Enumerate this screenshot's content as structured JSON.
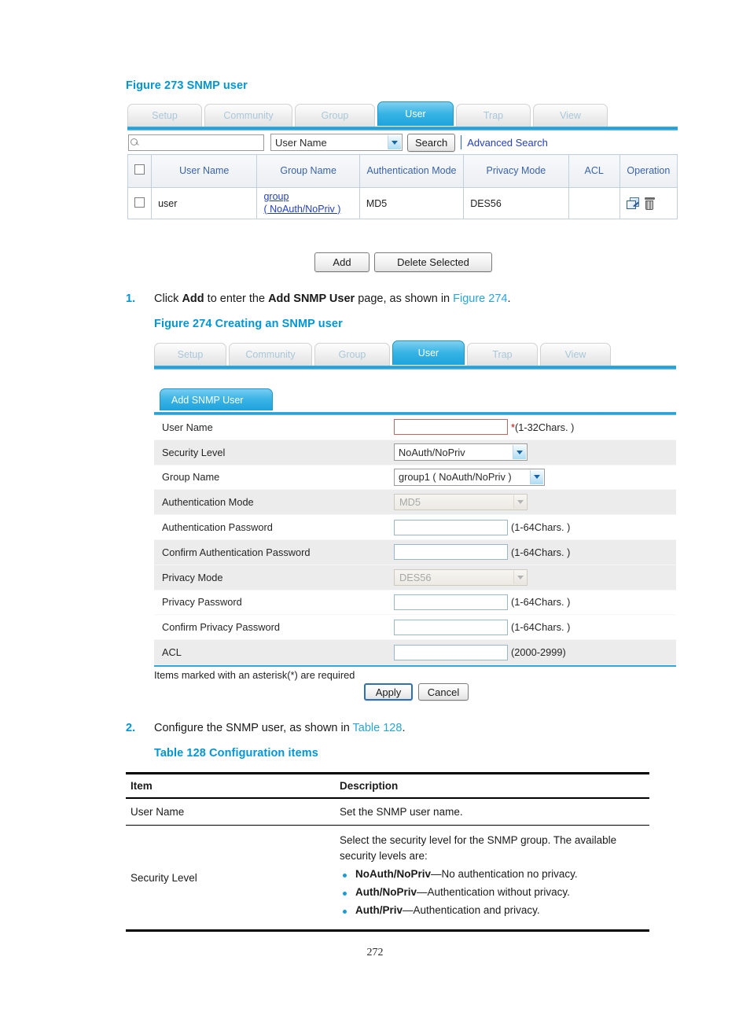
{
  "figure273": {
    "caption": "Figure 273 SNMP user",
    "tabs": [
      {
        "label": "Setup",
        "active": false
      },
      {
        "label": "Community",
        "active": false
      },
      {
        "label": "Group",
        "active": false
      },
      {
        "label": "User",
        "active": true
      },
      {
        "label": "Trap",
        "active": false
      },
      {
        "label": "View",
        "active": false
      }
    ],
    "search": {
      "input_value": "",
      "field_select": "User Name",
      "search_button": "Search",
      "advanced_link": "Advanced Search"
    },
    "table": {
      "headers": [
        "",
        "User Name",
        "Group Name",
        "Authentication Mode",
        "Privacy Mode",
        "ACL",
        "Operation"
      ],
      "rows": [
        {
          "user_name": "user",
          "group_name_line1": "group",
          "group_name_line2": "( NoAuth/NoPriv )",
          "auth_mode": "MD5",
          "privacy_mode": "DES56",
          "acl": "",
          "operation_icons": [
            "edit-icon",
            "delete-icon"
          ]
        }
      ]
    },
    "buttons": {
      "add": "Add",
      "delete_selected": "Delete Selected"
    }
  },
  "step1": {
    "number": "1.",
    "text_pre": "Click ",
    "bold1": "Add",
    "text_mid": " to enter the ",
    "bold2": "Add SNMP User",
    "text_post": " page, as shown in ",
    "ref": "Figure 274",
    "text_end": "."
  },
  "figure274": {
    "caption": "Figure 274 Creating an SNMP user",
    "tabs": [
      {
        "label": "Setup",
        "active": false
      },
      {
        "label": "Community",
        "active": false
      },
      {
        "label": "Group",
        "active": false
      },
      {
        "label": "User",
        "active": true
      },
      {
        "label": "Trap",
        "active": false
      },
      {
        "label": "View",
        "active": false
      }
    ],
    "panel_tab": "Add SNMP User",
    "fields": [
      {
        "label": "User Name",
        "type": "text",
        "value": "",
        "hint": "*(1-32Chars. )",
        "required": true,
        "shade": "white"
      },
      {
        "label": "Security Level",
        "type": "select",
        "value": "NoAuth/NoPriv",
        "hint": "",
        "disabled": false,
        "shade": "gray"
      },
      {
        "label": "Group Name",
        "type": "select",
        "value": "group1 ( NoAuth/NoPriv )",
        "hint": "",
        "disabled": false,
        "shade": "white"
      },
      {
        "label": "Authentication Mode",
        "type": "select",
        "value": "MD5",
        "hint": "",
        "disabled": true,
        "shade": "gray"
      },
      {
        "label": "Authentication Password",
        "type": "text",
        "value": "",
        "hint": "(1-64Chars. )",
        "required": false,
        "shade": "white"
      },
      {
        "label": "Confirm Authentication Password",
        "type": "text",
        "value": "",
        "hint": "(1-64Chars. )",
        "required": false,
        "shade": "gray"
      },
      {
        "label": "Privacy Mode",
        "type": "select",
        "value": "DES56",
        "hint": "",
        "disabled": true,
        "shade": "gray"
      },
      {
        "label": "Privacy Password",
        "type": "text",
        "value": "",
        "hint": "(1-64Chars. )",
        "required": false,
        "shade": "white"
      },
      {
        "label": "Confirm Privacy Password",
        "type": "text",
        "value": "",
        "hint": "(1-64Chars. )",
        "required": false,
        "shade": "white"
      },
      {
        "label": "ACL",
        "type": "text",
        "value": "",
        "hint": "(2000-2999)",
        "required": false,
        "shade": "gray"
      }
    ],
    "footnote": "Items marked with an asterisk(*) are required",
    "buttons": {
      "apply": "Apply",
      "cancel": "Cancel"
    }
  },
  "step2": {
    "number": "2.",
    "text_pre": "Configure the SNMP user, as shown in ",
    "ref": "Table 128",
    "text_end": "."
  },
  "table128": {
    "caption": "Table 128 Configuration items",
    "headers": [
      "Item",
      "Description"
    ],
    "rows": [
      {
        "item": "User Name",
        "description": "Set the SNMP user name.",
        "bullets": []
      },
      {
        "item": "Security Level",
        "description": "Select the security level for the SNMP group. The available security levels are:",
        "bullets": [
          {
            "term": "NoAuth/NoPriv",
            "desc": "—No authentication no privacy."
          },
          {
            "term": "Auth/NoPriv",
            "desc": "—Authentication without privacy."
          },
          {
            "term": "Auth/Priv",
            "desc": "—Authentication and privacy."
          }
        ]
      }
    ]
  },
  "footer": {
    "page_number": "272"
  },
  "colors": {
    "heading_blue": "#0096d6",
    "ref_blue": "#29a3dc",
    "tab_active": "#1fa4dd",
    "link_blue": "#2440c0",
    "bullet_blue": "#1b9ad6"
  }
}
